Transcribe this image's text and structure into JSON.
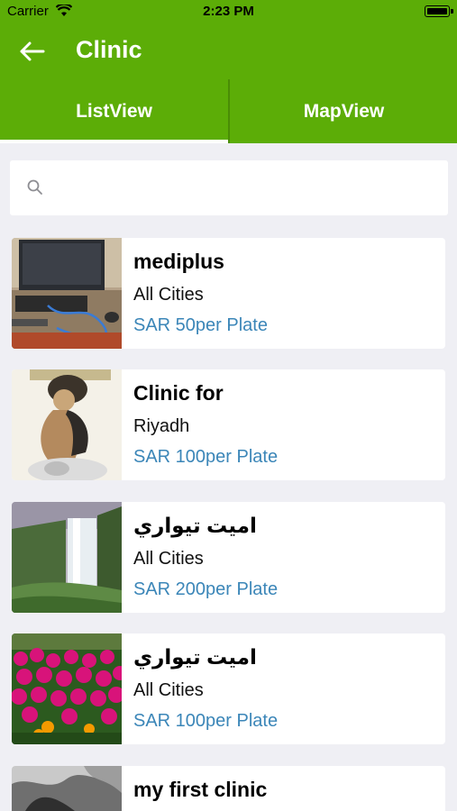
{
  "status_bar": {
    "carrier": "Carrier",
    "time": "2:23 PM"
  },
  "nav": {
    "title": "Clinic",
    "back_icon": "arrow-left-icon"
  },
  "tabs": [
    {
      "label": "ListView",
      "selected": true
    },
    {
      "label": "MapView",
      "selected": false
    }
  ],
  "search": {
    "placeholder": "",
    "value": ""
  },
  "colors": {
    "primary": "#5cad07",
    "price": "#3b86b8",
    "background": "#efeff4"
  },
  "clinics": [
    {
      "name": "mediplus",
      "city": "All Cities",
      "price": "SAR 50per Plate",
      "image": "computer-desk-photo"
    },
    {
      "name": "Clinic for",
      "city": "Riyadh",
      "price": "SAR 100per Plate",
      "image": "child-sculpture-photo"
    },
    {
      "name": "اميت تيواري",
      "city": "All Cities",
      "price": "SAR 200per Plate",
      "image": "waterfall-photo"
    },
    {
      "name": "اميت تيواري",
      "city": "All Cities",
      "price": "SAR 100per Plate",
      "image": "flowers-photo"
    },
    {
      "name": "my first clinic",
      "city": "",
      "price": "",
      "image": "grayscale-photo"
    }
  ]
}
